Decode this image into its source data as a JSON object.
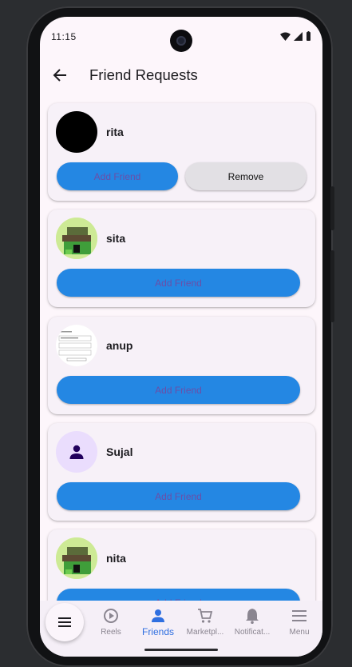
{
  "status": {
    "time": "11:15"
  },
  "appbar": {
    "title": "Friend Requests"
  },
  "requests": [
    {
      "name": "rita",
      "add_label": "Add Friend",
      "remove_label": "Remove",
      "avatar": "black-circle"
    },
    {
      "name": "sita",
      "add_label": "Add Friend",
      "avatar": "green-pixel-art"
    },
    {
      "name": "anup",
      "add_label": "Add Friend",
      "avatar": "screenshot-thumbnail"
    },
    {
      "name": "Sujal",
      "add_label": "Add Friend",
      "avatar": "person-icon"
    },
    {
      "name": "nita",
      "add_label": "Add Friend",
      "avatar": "green-pixel-art"
    }
  ],
  "nav": {
    "items": [
      {
        "label": "Reels",
        "icon": "play-circle-icon"
      },
      {
        "label": "Friends",
        "icon": "person-icon",
        "active": true
      },
      {
        "label": "Marketpl...",
        "icon": "cart-icon"
      },
      {
        "label": "Notificat...",
        "icon": "bell-icon"
      },
      {
        "label": "Menu",
        "icon": "menu-icon"
      }
    ]
  },
  "colors": {
    "accent": "#2487e3",
    "active_nav": "#2f6fe0",
    "background": "#fdf6fb"
  }
}
